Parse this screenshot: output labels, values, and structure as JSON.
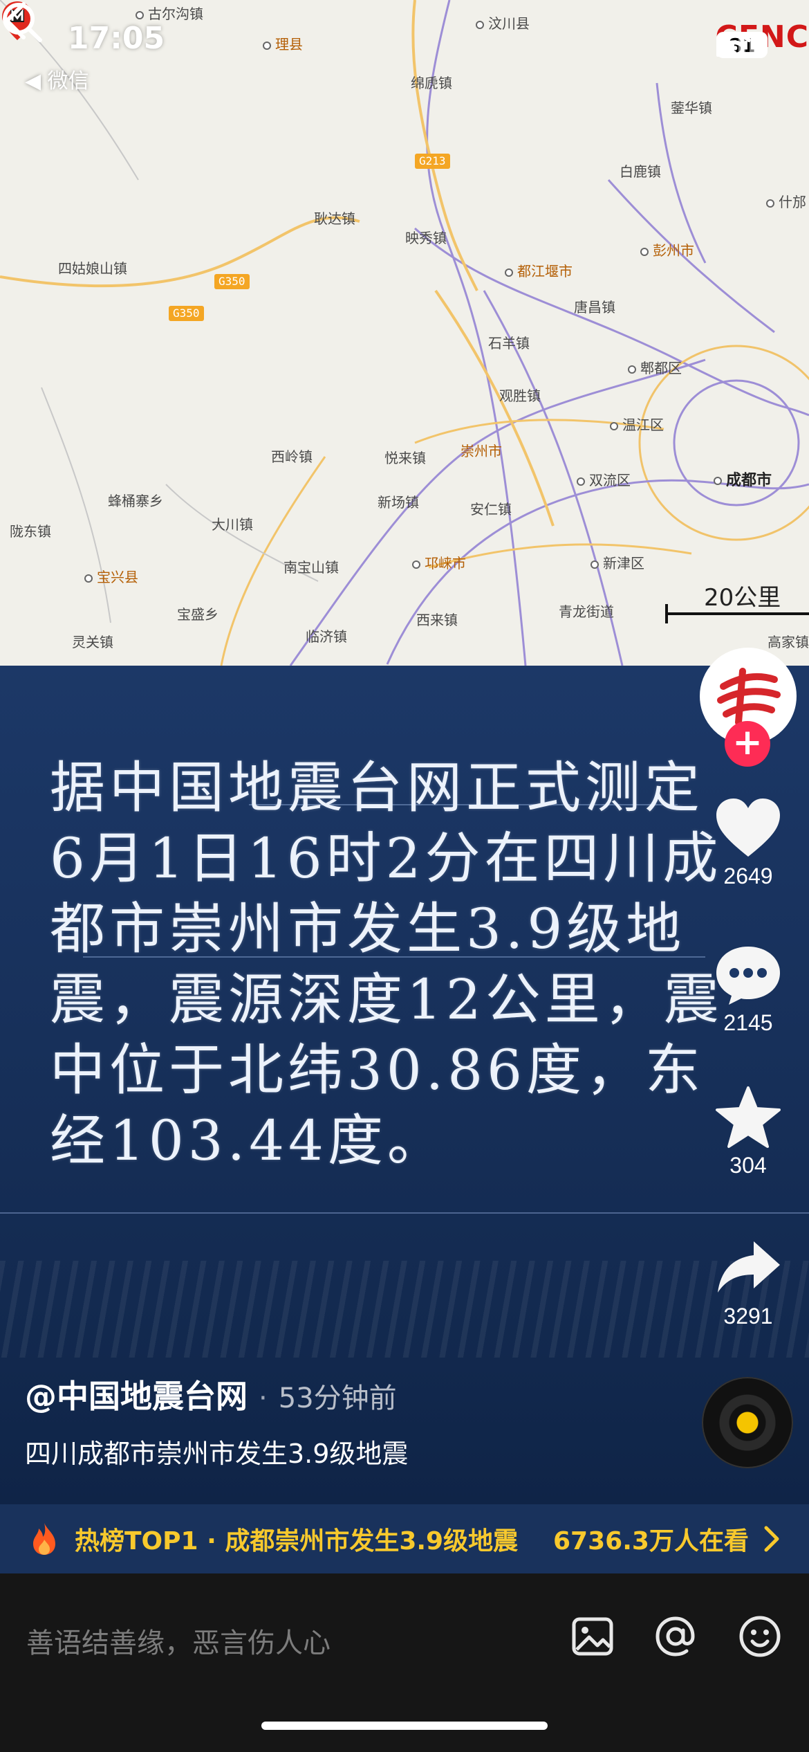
{
  "status_bar": {
    "time": "17:05",
    "back_app": "◀ 微信",
    "battery": "81"
  },
  "map": {
    "watermark": "CENC",
    "roads": [
      "G213",
      "G350",
      "G350"
    ],
    "places": [
      {
        "name": "古尔沟镇"
      },
      {
        "name": "理县"
      },
      {
        "name": "汶川县"
      },
      {
        "name": "绵虒镇"
      },
      {
        "name": "耿达镇"
      },
      {
        "name": "映秀镇"
      },
      {
        "name": "都江堰市"
      },
      {
        "name": "四姑娘山镇"
      },
      {
        "name": "唐昌镇"
      },
      {
        "name": "石羊镇"
      },
      {
        "name": "观胜镇"
      },
      {
        "name": "郫都区"
      },
      {
        "name": "温江区"
      },
      {
        "name": "成都市"
      },
      {
        "name": "崇州市"
      },
      {
        "name": "悦来镇"
      },
      {
        "name": "西岭镇"
      },
      {
        "name": "新场镇"
      },
      {
        "name": "安仁镇"
      },
      {
        "name": "双流区"
      },
      {
        "name": "蜂桶寨乡"
      },
      {
        "name": "大川镇"
      },
      {
        "name": "陇东镇"
      },
      {
        "name": "宝兴县"
      },
      {
        "name": "南宝山镇"
      },
      {
        "name": "邛崃市"
      },
      {
        "name": "新津区"
      },
      {
        "name": "宝盛乡"
      },
      {
        "name": "灵关镇"
      },
      {
        "name": "临济镇"
      },
      {
        "name": "西来镇"
      },
      {
        "name": "青龙街道"
      },
      {
        "name": "白鹿镇"
      },
      {
        "name": "彭州市"
      },
      {
        "name": "蓥华镇"
      },
      {
        "name": "什邡"
      },
      {
        "name": "高家镇"
      }
    ],
    "scale_label": "20公里"
  },
  "video": {
    "headline": "据中国地震台网正式测定6月1日16时2分在四川成都市崇州市发生3.9级地震，震源深度12公里，震中位于北纬30.86度，东经103.44度。"
  },
  "actions": {
    "likes": "2649",
    "comments": "2145",
    "favorites": "304",
    "shares": "3291"
  },
  "post": {
    "author": "@中国地震台网",
    "separator": "·",
    "time_ago": "53分钟前",
    "description": "四川成都市崇州市发生3.9级地震"
  },
  "hot": {
    "label": "热榜TOP1 · 成都崇州市发生3.9级地震",
    "views": "6736.3万人在看"
  },
  "comment": {
    "placeholder": "善语结善缘，恶言伤人心"
  },
  "colors": {
    "accent_red": "#fe2c55",
    "hot_yellow": "#f8c92d",
    "video_blue": "#17305a"
  },
  "icons": [
    "back-icon",
    "search-icon",
    "heart-icon",
    "comment-icon",
    "star-icon",
    "share-icon",
    "fire-icon",
    "chevron-right-icon",
    "image-icon",
    "at-icon",
    "emoji-icon"
  ]
}
